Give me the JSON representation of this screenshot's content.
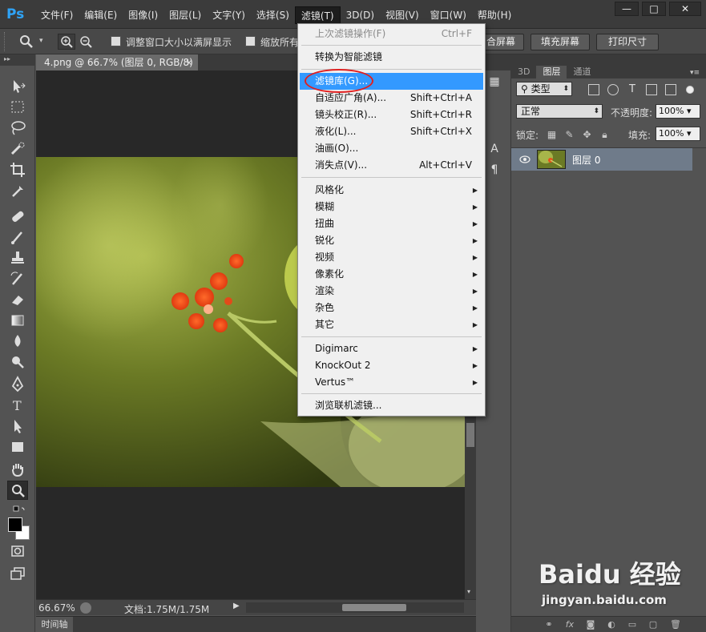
{
  "app": {
    "logo": "Ps",
    "menu": [
      "文件(F)",
      "编辑(E)",
      "图像(I)",
      "图层(L)",
      "文字(Y)",
      "选择(S)",
      "滤镜(T)",
      "3D(D)",
      "视图(V)",
      "窗口(W)",
      "帮助(H)"
    ],
    "active_menu_index": 6,
    "window_controls": [
      "—",
      "□",
      "✕"
    ]
  },
  "options": {
    "fit_window_label": "调整窗口大小以满屏显示",
    "zoom_all_label": "缩放所有",
    "fill_screen_partial": "合屏幕",
    "fill_screen": "填充屏幕",
    "print_size": "打印尺寸"
  },
  "document": {
    "tab_title": "4.png @ 66.7% (图层 0, RGB/8)",
    "tab_close": "×",
    "zoom": "66.67%",
    "doc_size": "文档:1.75M/1.75M"
  },
  "timeline": {
    "label": "时间轴"
  },
  "filter_menu": {
    "items": [
      {
        "label": "上次滤镜操作(F)",
        "shortcut": "Ctrl+F",
        "disabled": true
      },
      {
        "sep": true
      },
      {
        "label": "转换为智能滤镜"
      },
      {
        "sep": true
      },
      {
        "label": "滤镜库(G)...",
        "highlighted": true
      },
      {
        "label": "自适应广角(A)...",
        "shortcut": "Shift+Ctrl+A"
      },
      {
        "label": "镜头校正(R)...",
        "shortcut": "Shift+Ctrl+R"
      },
      {
        "label": "液化(L)...",
        "shortcut": "Shift+Ctrl+X"
      },
      {
        "label": "油画(O)..."
      },
      {
        "label": "消失点(V)...",
        "shortcut": "Alt+Ctrl+V"
      },
      {
        "sep": true
      },
      {
        "label": "风格化",
        "submenu": true
      },
      {
        "label": "模糊",
        "submenu": true
      },
      {
        "label": "扭曲",
        "submenu": true
      },
      {
        "label": "锐化",
        "submenu": true
      },
      {
        "label": "视频",
        "submenu": true
      },
      {
        "label": "像素化",
        "submenu": true
      },
      {
        "label": "渲染",
        "submenu": true
      },
      {
        "label": "杂色",
        "submenu": true
      },
      {
        "label": "其它",
        "submenu": true
      },
      {
        "sep": true
      },
      {
        "label": "Digimarc",
        "submenu": true
      },
      {
        "label": "KnockOut 2",
        "submenu": true
      },
      {
        "label": "Vertus™",
        "submenu": true
      },
      {
        "sep": true
      },
      {
        "label": "浏览联机滤镜..."
      }
    ]
  },
  "layers_panel": {
    "tabs": [
      "3D",
      "图层",
      "通道"
    ],
    "active_tab_index": 1,
    "filter_kind": "类型",
    "blend_mode": "正常",
    "opacity_label": "不透明度:",
    "opacity_value": "100%",
    "lock_label": "锁定:",
    "fill_label": "填充:",
    "fill_value": "100%",
    "layers": [
      {
        "name": "图层 0",
        "visible": true,
        "selected": true
      }
    ]
  },
  "watermark": {
    "brand": "Baidu 经验",
    "url": "jingyan.baidu.com"
  },
  "colors": {
    "menu_highlight": "#3399ff",
    "annotation_circle": "#e02020",
    "ps_blue": "#2fa3f6"
  },
  "tools": [
    "move-tool",
    "marquee-tool",
    "lasso-tool",
    "quick-select-tool",
    "crop-tool",
    "eyedropper-tool",
    "healing-tool",
    "brush-tool",
    "stamp-tool",
    "history-brush-tool",
    "eraser-tool",
    "gradient-tool",
    "blur-tool",
    "dodge-tool",
    "pen-tool",
    "type-tool",
    "path-select-tool",
    "shape-tool",
    "hand-tool",
    "zoom-tool"
  ],
  "type_tool_glyph": "T"
}
